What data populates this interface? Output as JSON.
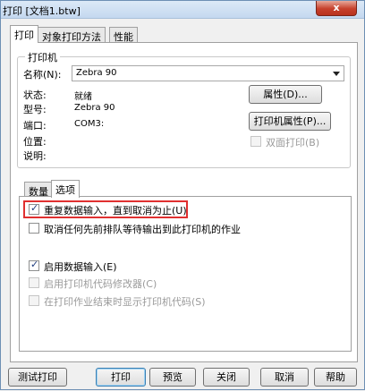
{
  "window": {
    "title": "打印 [文档1.btw]",
    "close_glyph": "x"
  },
  "tabs": [
    {
      "label": "打印",
      "active": true
    },
    {
      "label": "对象打印方法",
      "active": false
    },
    {
      "label": "性能",
      "active": false
    }
  ],
  "printer_group": {
    "title": "打印机",
    "name_label": "名称(N):",
    "name_value": "Zebra 90",
    "status_label": "状态:",
    "status_value": "就绪",
    "model_label": "型号:",
    "model_value": "Zebra 90",
    "port_label": "端口:",
    "port_value": "COM3:",
    "location_label": "位置:",
    "comment_label": "说明:",
    "properties_button": "属性(D)...",
    "printer_properties_button": "打印机属性(P)...",
    "duplex_label": "双面打印(B)"
  },
  "inner_tabs": [
    {
      "label": "数量",
      "active": false
    },
    {
      "label": "选项",
      "active": true
    }
  ],
  "options": [
    {
      "label": "重复数据输入，直到取消为止(U)",
      "checked": true,
      "disabled": false,
      "highlighted": true
    },
    {
      "label": "取消任何先前排队等待输出到此打印机的作业",
      "checked": false,
      "disabled": false,
      "highlighted": false
    },
    {
      "label": "启用数据输入(E)",
      "checked": true,
      "disabled": false,
      "highlighted": false
    },
    {
      "label": "启用打印机代码修改器(C)",
      "checked": false,
      "disabled": true,
      "highlighted": false
    },
    {
      "label": "在打印作业结束时显示打印机代码(S)",
      "checked": false,
      "disabled": true,
      "highlighted": false
    }
  ],
  "bottom_buttons": {
    "test_print": "测试打印",
    "print": "打印",
    "preview": "预览",
    "close": "关闭",
    "cancel": "取消",
    "help": "帮助"
  },
  "colors": {
    "highlight_border": "#e03030",
    "check_color": "#1d3b7e"
  }
}
